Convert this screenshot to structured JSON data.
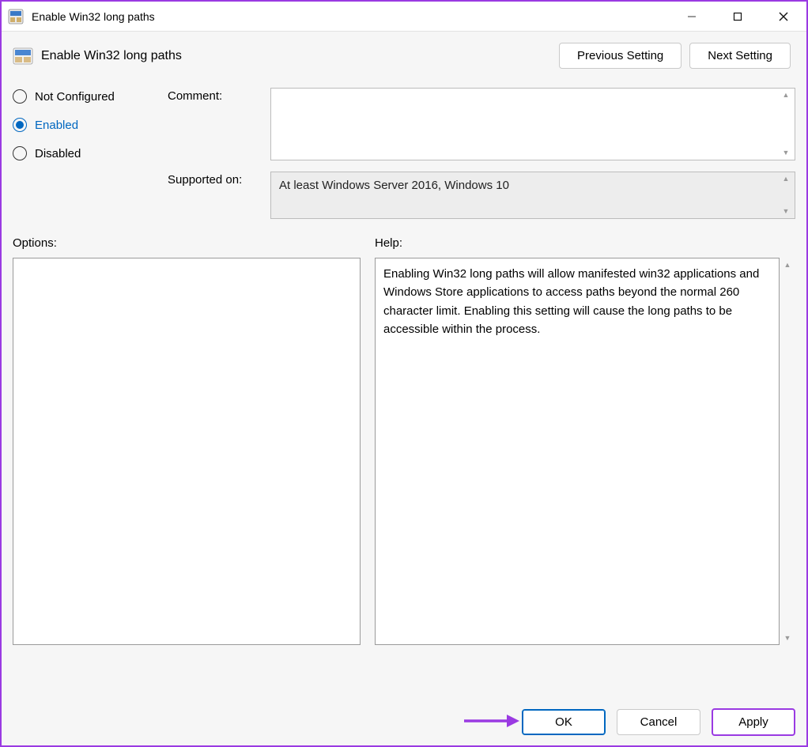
{
  "window": {
    "title": "Enable Win32 long paths"
  },
  "header": {
    "setting_title": "Enable Win32 long paths",
    "prev_btn": "Previous Setting",
    "next_btn": "Next Setting"
  },
  "radios": {
    "not_configured": "Not Configured",
    "enabled": "Enabled",
    "disabled": "Disabled",
    "selected": "enabled"
  },
  "fields": {
    "comment_label": "Comment:",
    "comment_value": "",
    "supported_label": "Supported on:",
    "supported_value": "At least Windows Server 2016, Windows 10"
  },
  "panels": {
    "options_label": "Options:",
    "help_label": "Help:",
    "help_text": "Enabling Win32 long paths will allow manifested win32 applications and Windows Store applications to access paths beyond the normal 260 character limit.  Enabling this setting will cause the long paths to be accessible within the process."
  },
  "footer": {
    "ok": "OK",
    "cancel": "Cancel",
    "apply": "Apply"
  }
}
